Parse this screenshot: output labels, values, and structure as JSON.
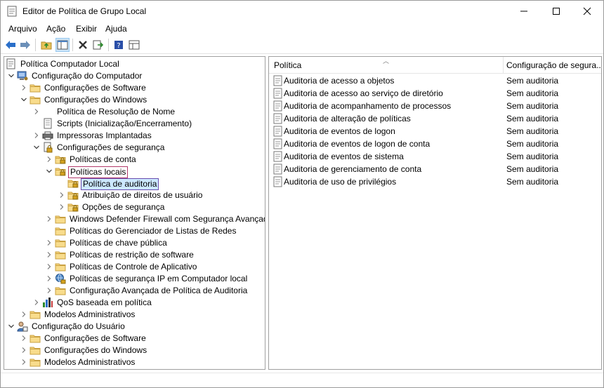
{
  "window": {
    "title": "Editor de Política de Grupo Local"
  },
  "menu": [
    "Arquivo",
    "Ação",
    "Exibir",
    "Ajuda"
  ],
  "toolbar": [
    "back-icon",
    "forward-icon",
    "up-folder-icon",
    "show-hide-tree-icon",
    "delete-icon",
    "export-list-icon",
    "help-icon",
    "properties-view-icon"
  ],
  "tree": [
    {
      "label": "Política Computador Local",
      "level": 0,
      "expander": "",
      "icon": "policy-doc"
    },
    {
      "label": "Configuração do Computador",
      "level": 1,
      "expander": "open",
      "icon": "computer"
    },
    {
      "label": "Configurações de Software",
      "level": 2,
      "expander": "closed",
      "icon": "folder"
    },
    {
      "label": "Configurações do Windows",
      "level": 2,
      "expander": "open",
      "icon": "folder"
    },
    {
      "label": "Política de Resolução de Nome",
      "level": 3,
      "expander": "closed",
      "icon": "none"
    },
    {
      "label": "Scripts (Inicialização/Encerramento)",
      "level": 3,
      "expander": "",
      "icon": "script"
    },
    {
      "label": "Impressoras Implantadas",
      "level": 3,
      "expander": "closed",
      "icon": "printer"
    },
    {
      "label": "Configurações de segurança",
      "level": 3,
      "expander": "open",
      "icon": "security"
    },
    {
      "label": "Políticas de conta",
      "level": 4,
      "expander": "closed",
      "icon": "lock-folder"
    },
    {
      "label": "Políticas locais",
      "level": 4,
      "expander": "open",
      "icon": "lock-folder",
      "state": "boxed"
    },
    {
      "label": "Política de auditoria",
      "level": 5,
      "expander": "",
      "icon": "lock-folder",
      "state": "selected"
    },
    {
      "label": "Atribuição de direitos de usuário",
      "level": 5,
      "expander": "closed",
      "icon": "lock-folder"
    },
    {
      "label": "Opções de segurança",
      "level": 5,
      "expander": "closed",
      "icon": "lock-folder"
    },
    {
      "label": "Windows Defender Firewall com Segurança Avançada",
      "level": 4,
      "expander": "closed",
      "icon": "folder"
    },
    {
      "label": "Políticas do Gerenciador de Listas de Redes",
      "level": 4,
      "expander": "",
      "icon": "folder"
    },
    {
      "label": "Políticas de chave pública",
      "level": 4,
      "expander": "closed",
      "icon": "folder"
    },
    {
      "label": "Políticas de restrição de software",
      "level": 4,
      "expander": "closed",
      "icon": "folder"
    },
    {
      "label": "Políticas de Controle de Aplicativo",
      "level": 4,
      "expander": "closed",
      "icon": "folder"
    },
    {
      "label": "Políticas de segurança IP em Computador local",
      "level": 4,
      "expander": "closed",
      "icon": "ipsec"
    },
    {
      "label": "Configuração Avançada de Política de Auditoria",
      "level": 4,
      "expander": "closed",
      "icon": "folder"
    },
    {
      "label": "QoS baseada em política",
      "level": 3,
      "expander": "closed",
      "icon": "chart"
    },
    {
      "label": "Modelos Administrativos",
      "level": 2,
      "expander": "closed",
      "icon": "folder"
    },
    {
      "label": "Configuração do Usuário",
      "level": 1,
      "expander": "open",
      "icon": "user"
    },
    {
      "label": "Configurações de Software",
      "level": 2,
      "expander": "closed",
      "icon": "folder"
    },
    {
      "label": "Configurações do Windows",
      "level": 2,
      "expander": "closed",
      "icon": "folder"
    },
    {
      "label": "Modelos Administrativos",
      "level": 2,
      "expander": "closed",
      "icon": "folder"
    }
  ],
  "list": {
    "columns": [
      "Política",
      "Configuração de segura..."
    ],
    "rows": [
      {
        "name": "Auditoria de acesso a objetos",
        "value": "Sem auditoria"
      },
      {
        "name": "Auditoria de acesso ao serviço de diretório",
        "value": "Sem auditoria"
      },
      {
        "name": "Auditoria de acompanhamento de processos",
        "value": "Sem auditoria"
      },
      {
        "name": "Auditoria de alteração de políticas",
        "value": "Sem auditoria"
      },
      {
        "name": "Auditoria de eventos de logon",
        "value": "Sem auditoria"
      },
      {
        "name": "Auditoria de eventos de logon de conta",
        "value": "Sem auditoria"
      },
      {
        "name": "Auditoria de eventos de sistema",
        "value": "Sem auditoria"
      },
      {
        "name": "Auditoria de gerenciamento de conta",
        "value": "Sem auditoria"
      },
      {
        "name": "Auditoria de uso de privilégios",
        "value": "Sem auditoria"
      }
    ]
  },
  "colors": {
    "selection": "#cce8ff",
    "selection_border": "#6a4caf",
    "boxed_border": "#b23a6b",
    "folder": "#e8c35a",
    "toolbar_blue": "#2a6fc9"
  }
}
